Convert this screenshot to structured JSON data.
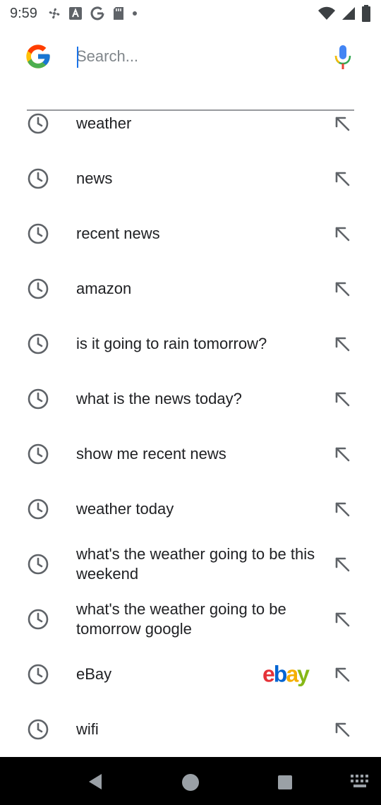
{
  "status_bar": {
    "time": "9:59",
    "icons_left": [
      "fan-icon",
      "a-icon",
      "google-g-icon",
      "sd-card-icon",
      "dot-icon"
    ],
    "icons_right": [
      "wifi-icon",
      "signal-icon",
      "battery-icon"
    ]
  },
  "search": {
    "placeholder": "Search...",
    "value": ""
  },
  "suggestions": [
    {
      "text": "weather"
    },
    {
      "text": "news"
    },
    {
      "text": "recent news"
    },
    {
      "text": "amazon"
    },
    {
      "text": "is it going to rain tomorrow?"
    },
    {
      "text": "what is the news today?"
    },
    {
      "text": "show me recent news"
    },
    {
      "text": "weather today"
    },
    {
      "text": "what's the weather going to be this weekend"
    },
    {
      "text": "what's the weather going to be tomorrow google"
    },
    {
      "text": "eBay",
      "logo": "ebay"
    },
    {
      "text": "wifi"
    }
  ],
  "colors": {
    "accent": "#1a73e8",
    "icon_gray": "#5f6368",
    "nav_bg": "#000000"
  }
}
